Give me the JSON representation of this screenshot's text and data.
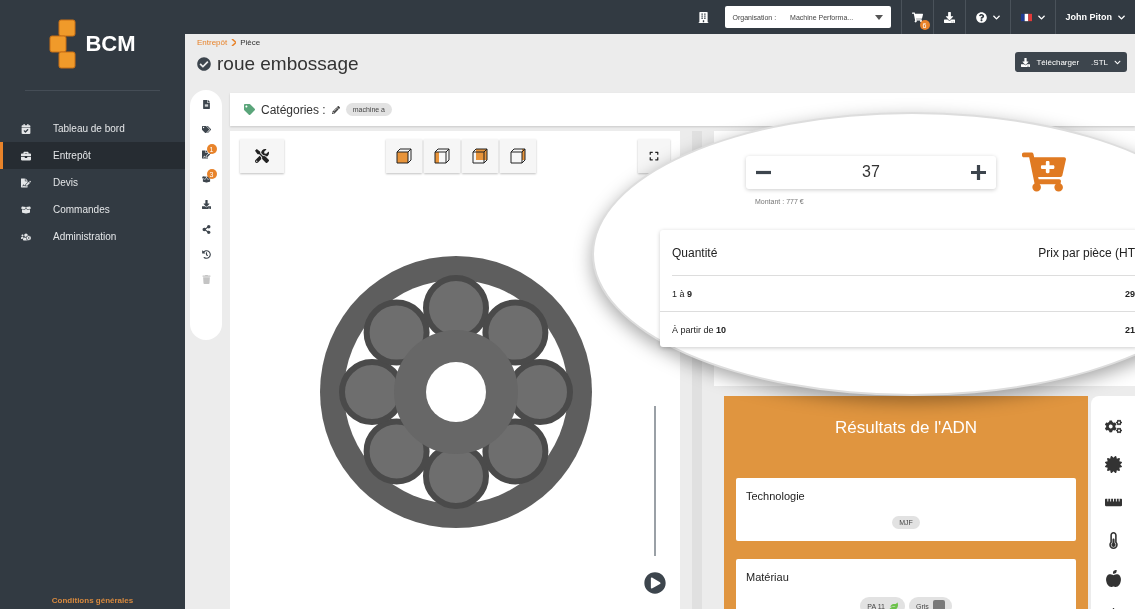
{
  "topbar": {
    "organisation_label": "Organisation :",
    "organisation_value": "Machine Performa...",
    "cart_count": "6",
    "user": "John Piton"
  },
  "sidebar": {
    "logo": "BCM",
    "items": [
      {
        "kind": "dashboard",
        "label": "Tableau de bord",
        "selected": false
      },
      {
        "kind": "warehouse",
        "label": "Entrepôt",
        "selected": true
      },
      {
        "kind": "quotes",
        "label": "Devis",
        "selected": false
      },
      {
        "kind": "orders",
        "label": "Commandes",
        "selected": false
      },
      {
        "kind": "admin",
        "label": "Administration",
        "selected": false
      }
    ],
    "footer": "Conditions générales"
  },
  "header": {
    "breadcrumb": [
      "Entrepôt",
      "Pièce"
    ],
    "title": "roue embossage",
    "download_button": "Télécharger",
    "format": ".STL"
  },
  "tools": [
    {
      "kind": "document"
    },
    {
      "kind": "tag"
    },
    {
      "kind": "quote",
      "badge": "1"
    },
    {
      "kind": "orders",
      "badge": "3"
    },
    {
      "kind": "download"
    },
    {
      "kind": "share"
    },
    {
      "kind": "history"
    },
    {
      "kind": "delete",
      "disabled": true
    }
  ],
  "categories": {
    "label": "Catégories :",
    "tags": [
      "machine a"
    ]
  },
  "order": {
    "quantity": "37",
    "amount": "Montant : 777 €",
    "price_table": {
      "columns": [
        "Quantité",
        "Prix par pièce (HT"
      ],
      "rows": [
        [
          "1 à **9**",
          "29"
        ],
        [
          "À partir de **10**",
          "21"
        ]
      ]
    }
  },
  "adn": {
    "title": "Résultats de l'ADN",
    "sections": [
      {
        "title": "Technologie",
        "chips": [
          {
            "kind": "plain",
            "label": "MJF"
          }
        ]
      },
      {
        "title": "Matériau",
        "chips": [
          {
            "kind": "eco",
            "label": "PA 11"
          },
          {
            "kind": "swatch",
            "label": "Gris",
            "color": "#7a7a7a"
          }
        ]
      }
    ]
  }
}
